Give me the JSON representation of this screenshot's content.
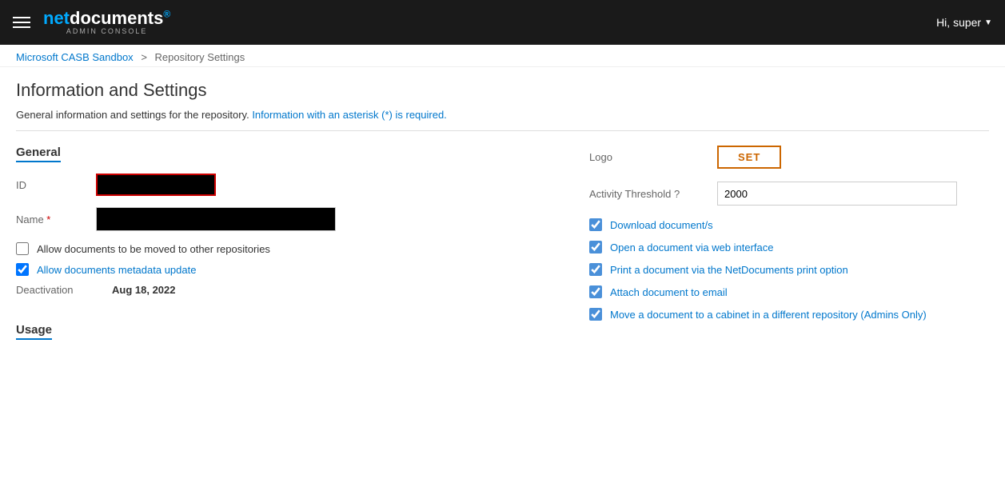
{
  "header": {
    "brand_net": "net",
    "brand_docs": "documents",
    "brand_trademark": "®",
    "brand_sub": "ADMIN CONSOLE",
    "greeting": "Hi, super",
    "hamburger_label": "menu"
  },
  "breadcrumb": {
    "parent_label": "Microsoft CASB Sandbox",
    "separator": ">",
    "current": "Repository Settings"
  },
  "page": {
    "title": "Information and Settings",
    "description_prefix": "General information and settings for the repository. ",
    "description_asterisk": "Information with an asterisk (*) is required.",
    "section_general": "General",
    "section_usage": "Usage"
  },
  "fields": {
    "id_label": "ID",
    "name_label": "Name",
    "name_required_marker": "*",
    "deactivation_label": "Deactivation",
    "deactivation_value": "Aug 18, 2022"
  },
  "checkboxes_left": [
    {
      "id": "chk-move",
      "label": "Allow documents to be moved to other repositories",
      "checked": false,
      "link": false
    },
    {
      "id": "chk-metadata",
      "label": "Allow documents metadata update",
      "checked": true,
      "link": true
    }
  ],
  "right_section": {
    "logo_label": "Logo",
    "set_button": "SET",
    "threshold_label": "Activity Threshold ?",
    "threshold_value": "2000"
  },
  "checkboxes_right": [
    {
      "id": "chk-download",
      "label": "Download document/s",
      "checked": true
    },
    {
      "id": "chk-web",
      "label": "Open a document via web interface",
      "checked": true
    },
    {
      "id": "chk-print",
      "label": "Print a document via the NetDocuments print option",
      "checked": true
    },
    {
      "id": "chk-email",
      "label": "Attach document to email",
      "checked": true
    },
    {
      "id": "chk-cabinet",
      "label": "Move a document to a cabinet in a different repository (Admins Only)",
      "checked": true
    }
  ]
}
